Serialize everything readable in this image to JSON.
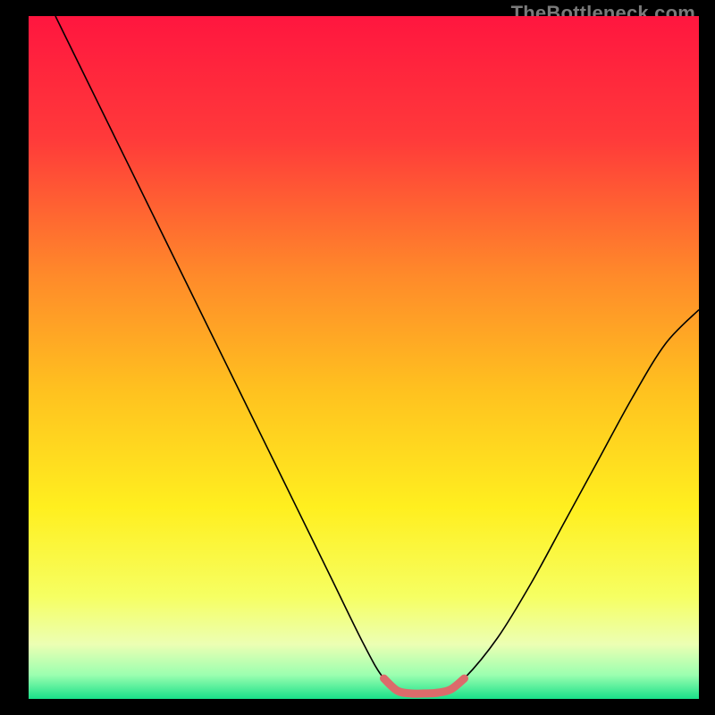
{
  "watermark": "TheBottleneck.com",
  "chart_data": {
    "type": "line",
    "title": "",
    "xlabel": "",
    "ylabel": "",
    "xlim": [
      0,
      100
    ],
    "ylim": [
      0,
      100
    ],
    "grid": false,
    "legend": false,
    "series": [
      {
        "name": "bottleneck-curve",
        "color": "#000000",
        "x": [
          4,
          10,
          15,
          20,
          25,
          30,
          35,
          40,
          45,
          50,
          53,
          56,
          59,
          62,
          65,
          70,
          75,
          80,
          85,
          90,
          95,
          100
        ],
        "y": [
          100,
          88,
          78,
          68,
          58,
          48,
          38,
          28,
          18,
          8,
          3,
          1,
          1,
          1,
          3,
          9,
          17,
          26,
          35,
          44,
          52,
          57
        ]
      },
      {
        "name": "optimal-zone-highlight",
        "color": "#dc6b6b",
        "x": [
          53,
          55,
          57,
          59,
          61,
          63,
          65
        ],
        "y": [
          3,
          1.2,
          0.8,
          0.8,
          0.9,
          1.4,
          3
        ]
      }
    ],
    "background_gradient": {
      "type": "vertical",
      "stops": [
        {
          "pos": 0.0,
          "color": "#ff163f"
        },
        {
          "pos": 0.18,
          "color": "#ff3a3a"
        },
        {
          "pos": 0.38,
          "color": "#ff8a2a"
        },
        {
          "pos": 0.55,
          "color": "#ffc21f"
        },
        {
          "pos": 0.72,
          "color": "#ffef1f"
        },
        {
          "pos": 0.85,
          "color": "#f6ff62"
        },
        {
          "pos": 0.92,
          "color": "#ecffb3"
        },
        {
          "pos": 0.965,
          "color": "#9bffb0"
        },
        {
          "pos": 1.0,
          "color": "#19e089"
        }
      ]
    }
  }
}
